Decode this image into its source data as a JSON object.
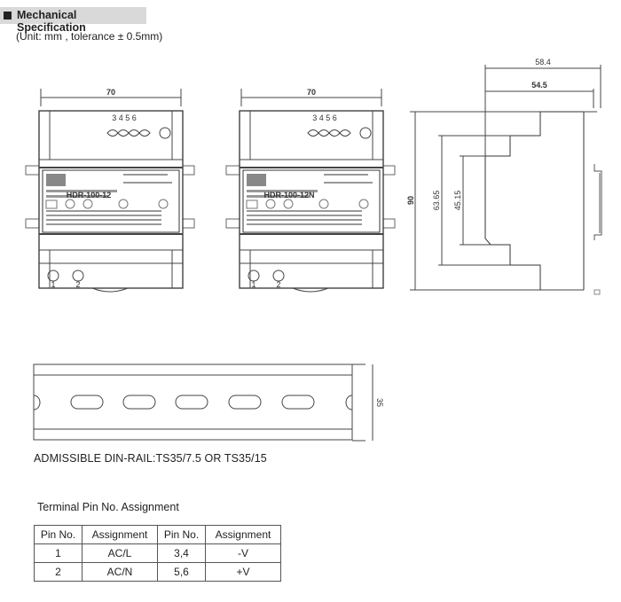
{
  "header": {
    "title": "Mechanical Specification",
    "subtitle": "(Unit: mm , tolerance ± 0.5mm)"
  },
  "front_views": [
    {
      "model": "HDR-100-12",
      "width_dim": "70",
      "top_pins": "3 4 5 6",
      "bottom_pins": [
        "1",
        "2"
      ]
    },
    {
      "model": "HDR-100-12N",
      "width_dim": "70",
      "top_pins": "3 4 5 6",
      "bottom_pins": [
        "1",
        "2"
      ]
    }
  ],
  "side_view": {
    "depth_total": "58.4",
    "depth_body": "54.5",
    "height": "90",
    "step_height": "63.65",
    "front_height": "45.15"
  },
  "din_rail": {
    "height_dim": "35",
    "note": "ADMISSIBLE DIN-RAIL:TS35/7.5 OR TS35/15"
  },
  "pin_table": {
    "title": "Terminal Pin No.  Assignment",
    "headers": [
      "Pin No.",
      "Assignment",
      "Pin No.",
      "Assignment"
    ],
    "rows": [
      [
        "1",
        "AC/L",
        "3,4",
        "-V"
      ],
      [
        "2",
        "AC/N",
        "5,6",
        "+V"
      ]
    ]
  }
}
